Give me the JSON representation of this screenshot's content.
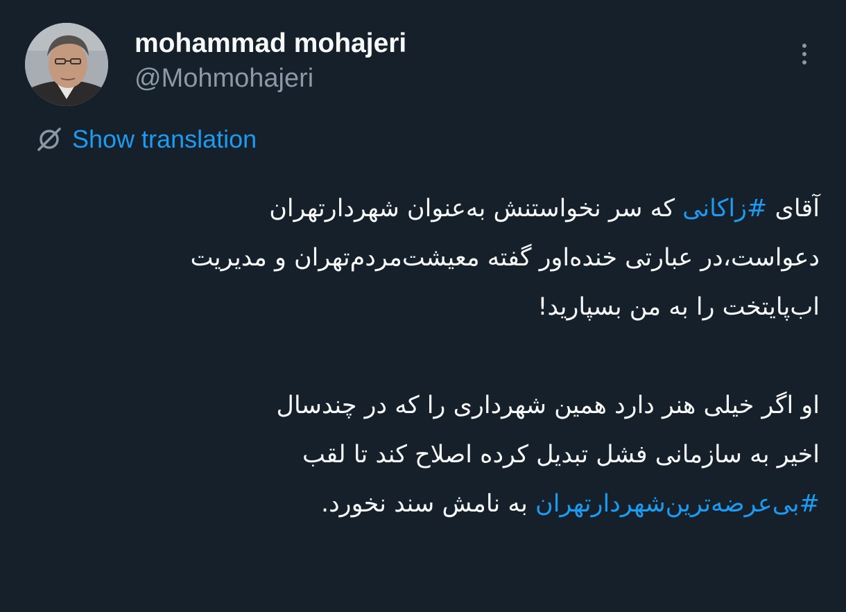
{
  "author": {
    "display_name": "mohammad mohajeri",
    "handle": "@Mohmohajeri"
  },
  "translation": {
    "label": "Show translation",
    "icon": "no-translate-icon"
  },
  "menu": {
    "icon": "more-vertical-icon"
  },
  "tweet": {
    "line1_before": "آقای ",
    "hashtag1": "#زاکانی",
    "line1_after": " که سر نخواستنش به‌عنوان شهردارتهران",
    "line2": "دعواست،در عبارتی خنده‌اور گفته معیشت‌مردم‌تهران و مدیریت",
    "line3": "اب‌پایتخت را به من بسپارید!",
    "line4": "او اگر خیلی هنر دارد همین شهرداری را که در چندسال",
    "line5": "اخیر به سازمانی فشل تبدیل  کرده اصلاح کند تا لقب",
    "hashtag2": "#بی‌عرضه‌ترین‌شهردارتهران",
    "line6_after": " به نامش سند نخورد."
  },
  "colors": {
    "background": "#15202b",
    "text": "#f7f9f9",
    "secondary": "#8b98a5",
    "accent": "#1d9bf0"
  }
}
